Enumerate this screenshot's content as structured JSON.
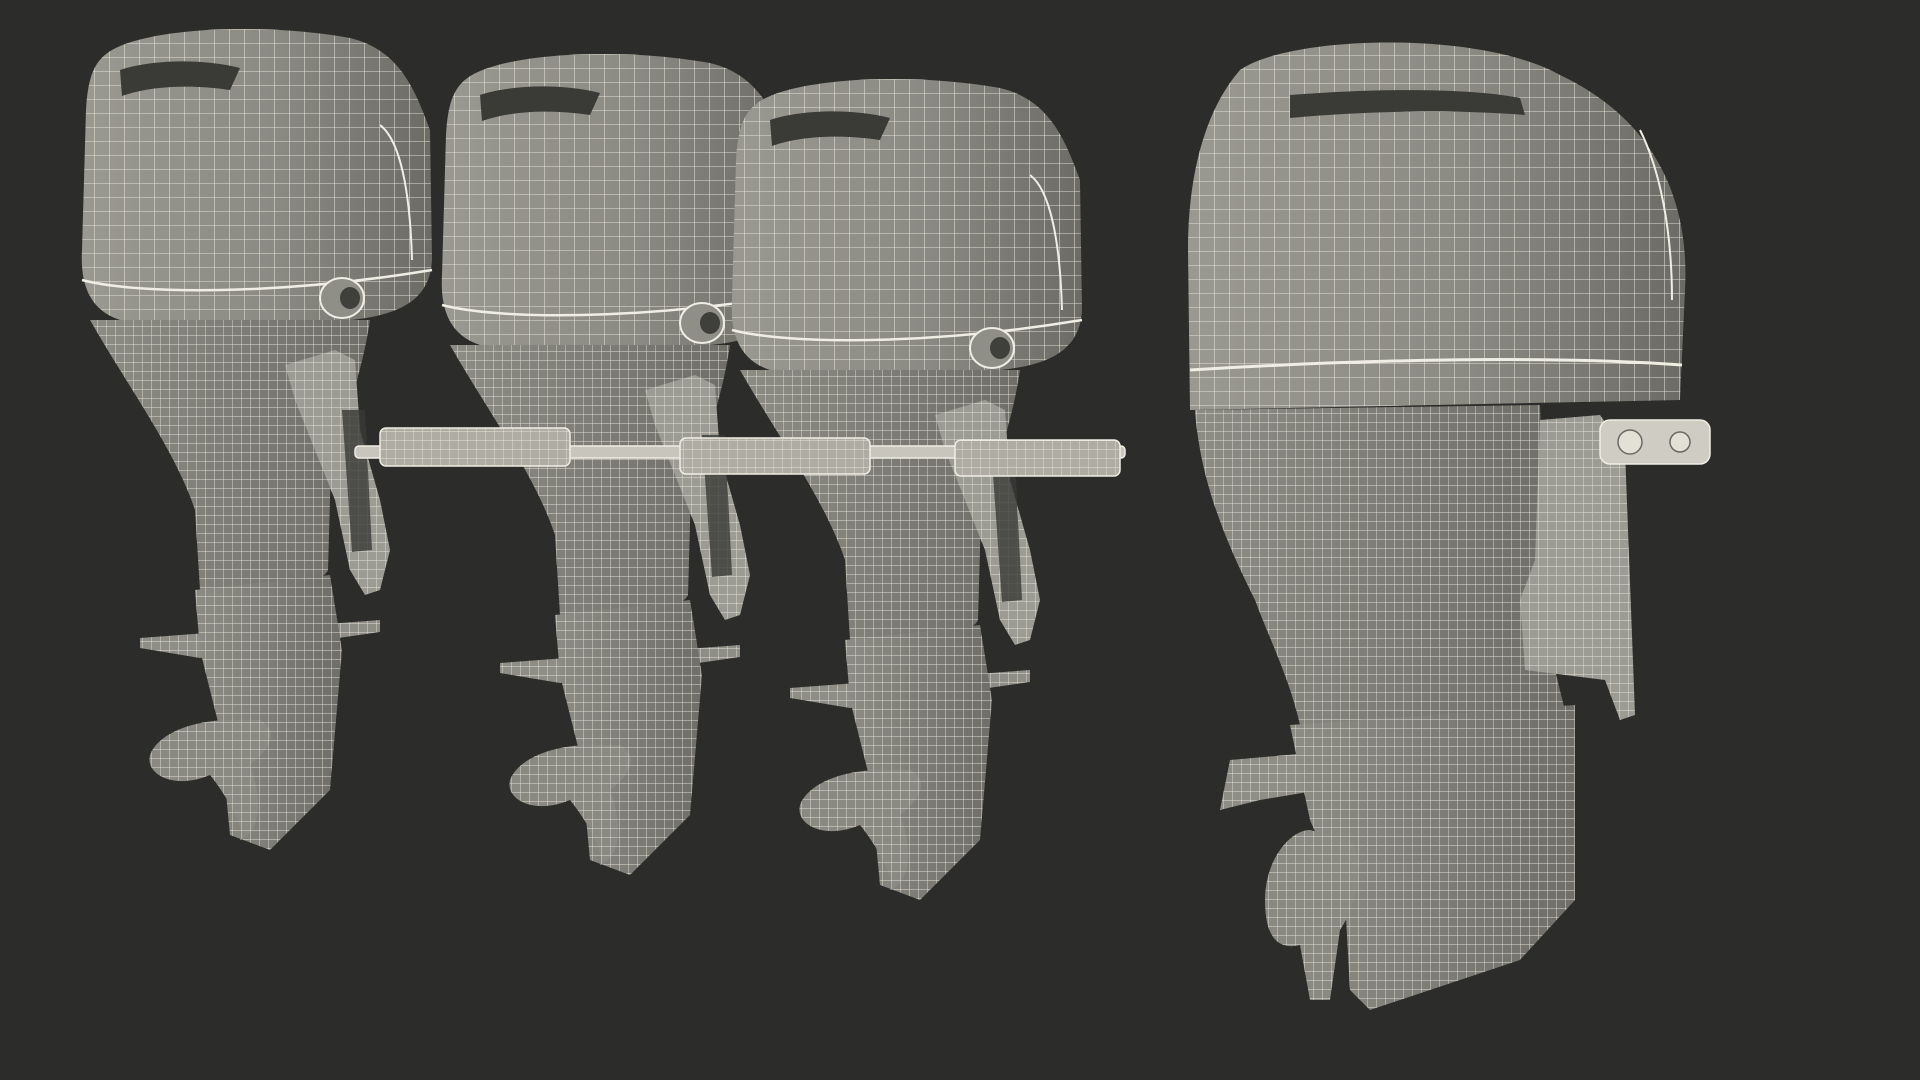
{
  "scene": {
    "background": "#2c2c2a",
    "subject": "outboard-motor-wireframe-render",
    "views": [
      "triple-engine-rig-three-quarter",
      "single-engine-side"
    ],
    "engine_count_left": 3,
    "colors": {
      "cowl_fill": "#8e8d86",
      "cowl_shadow": "#5f5e58",
      "wire": "#e9e7dc",
      "metal": "#b9b7ad",
      "dark_recess": "#3a3a37"
    }
  }
}
